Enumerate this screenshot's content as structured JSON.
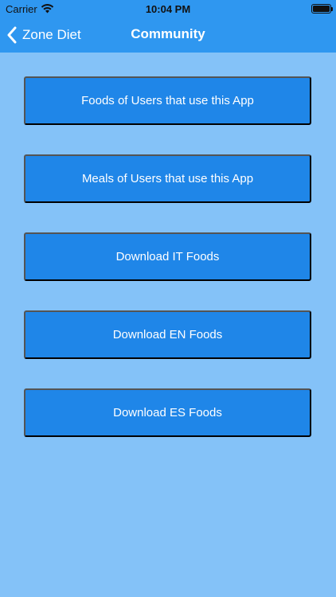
{
  "status_bar": {
    "carrier": "Carrier",
    "time": "10:04 PM",
    "wifi_icon": "wifi-icon",
    "battery_icon": "battery-icon",
    "battery_level": 1.0
  },
  "nav": {
    "back_label": "Zone Diet",
    "back_icon": "chevron-left-icon",
    "title": "Community"
  },
  "menu": {
    "items": [
      {
        "label": "Foods of Users that use this App"
      },
      {
        "label": "Meals of Users that use this App"
      },
      {
        "label": "Download IT Foods"
      },
      {
        "label": "Download EN Foods"
      },
      {
        "label": "Download ES Foods"
      }
    ]
  },
  "colors": {
    "header": "#2f97f0",
    "background": "#84c2f8",
    "button": "#1f86e8",
    "button_text": "#ffffff"
  }
}
